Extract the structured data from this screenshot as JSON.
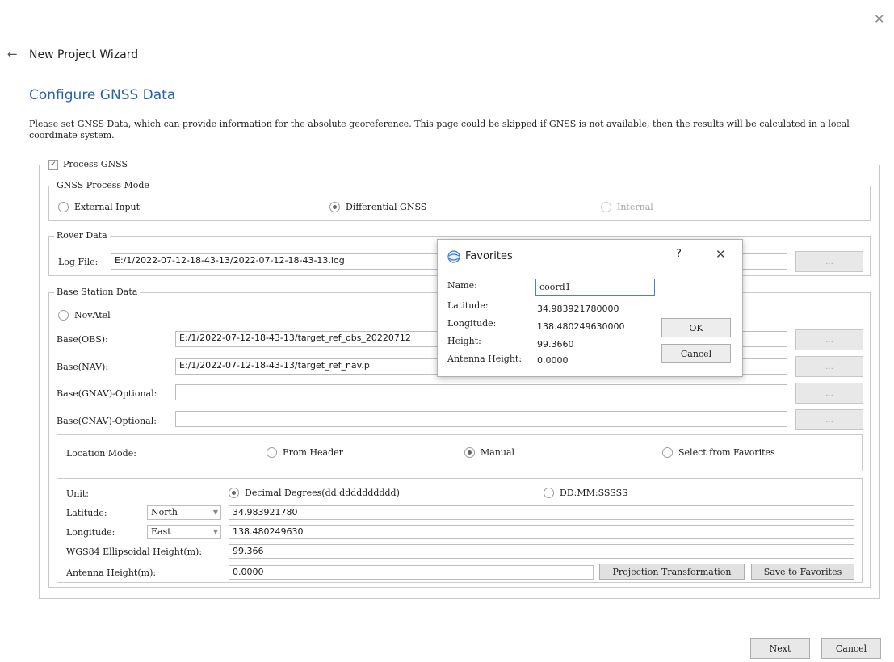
{
  "window": {
    "close_glyph": "✕"
  },
  "wizard": {
    "back_glyph": "←",
    "title": "New Project Wizard"
  },
  "page": {
    "title": "Configure GNSS Data",
    "description": "Please set GNSS Data, which can provide information for the absolute georeference. This page could be skipped if GNSS is not available, then the results will be calculated in a local coordinate system."
  },
  "process_gnss": {
    "label": "Process GNSS",
    "checked": true,
    "check_glyph": "✓"
  },
  "process_mode": {
    "legend": "GNSS Process Mode",
    "options": [
      {
        "label": "External Input",
        "selected": false,
        "enabled": true
      },
      {
        "label": "Differential GNSS",
        "selected": true,
        "enabled": true
      },
      {
        "label": "Internal",
        "selected": false,
        "enabled": false
      }
    ]
  },
  "rover": {
    "legend": "Rover Data",
    "log_file_label": "Log File:",
    "log_file_value": "E:/1/2022-07-12-18-43-13/2022-07-12-18-43-13.log",
    "browse_label": "..."
  },
  "base_station": {
    "legend": "Base Station Data",
    "novatel_label": "NovAtel",
    "rows": [
      {
        "label": "Base(OBS):",
        "value": "E:/1/2022-07-12-18-43-13/target_ref_obs_20220712",
        "browse": "..."
      },
      {
        "label": "Base(NAV):",
        "value": "E:/1/2022-07-12-18-43-13/target_ref_nav.p",
        "browse": "..."
      },
      {
        "label": "Base(GNAV)-Optional:",
        "value": "",
        "browse": "..."
      },
      {
        "label": "Base(CNAV)-Optional:",
        "value": "",
        "browse": "..."
      }
    ]
  },
  "location_mode": {
    "label": "Location Mode:",
    "options": [
      {
        "label": "From Header",
        "selected": false
      },
      {
        "label": "Manual",
        "selected": true
      },
      {
        "label": "Select from Favorites",
        "selected": false
      }
    ]
  },
  "coordinates": {
    "unit_label": "Unit:",
    "unit_options": [
      {
        "label": "Decimal Degrees(dd.dddddddddd)",
        "selected": true
      },
      {
        "label": "DD:MM:SSSSS",
        "selected": false
      }
    ],
    "latitude_label": "Latitude:",
    "latitude_dir": "North",
    "latitude_value": "34.983921780",
    "longitude_label": "Longitude:",
    "longitude_dir": "East",
    "longitude_value": "138.480249630",
    "height_label": "WGS84 Ellipsoidal Height(m):",
    "height_value": "99.366",
    "antenna_label": "Antenna Height(m):",
    "antenna_value": "0.0000",
    "projection_button": "Projection Transformation",
    "save_favorites_button": "Save to Favorites",
    "combo_arrow": "▼"
  },
  "favorites_dialog": {
    "title": "Favorites",
    "help_glyph": "?",
    "close_glyph": "✕",
    "name_label": "Name:",
    "name_value": "coord1",
    "latitude_label": "Latitude:",
    "latitude_value": "34.983921780000",
    "longitude_label": "Longitude:",
    "longitude_value": "138.480249630000",
    "height_label": "Height:",
    "height_value": "99.3660",
    "antenna_label": "Antenna Height:",
    "antenna_value": "0.0000",
    "ok_button": "OK",
    "cancel_button": "Cancel"
  },
  "footer": {
    "next_button": "Next",
    "cancel_button": "Cancel"
  }
}
